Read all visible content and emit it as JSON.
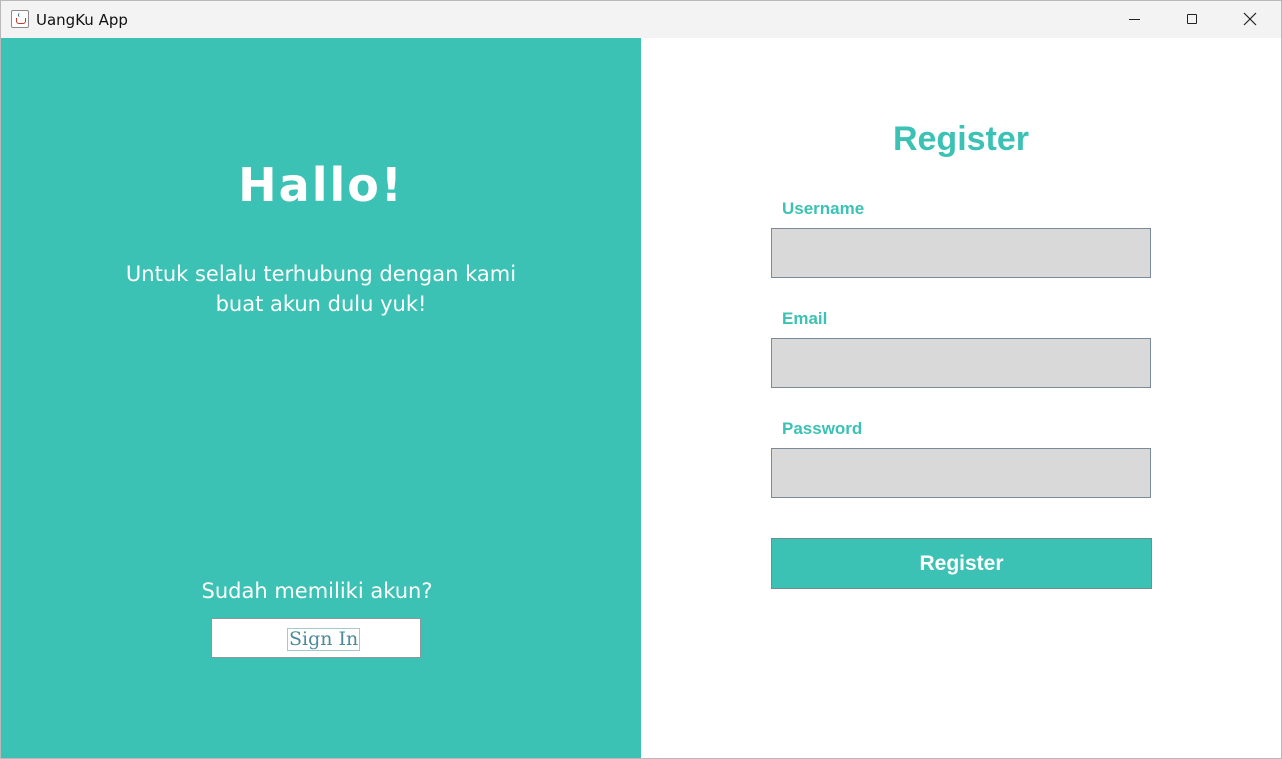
{
  "window": {
    "title": "UangKu App",
    "app_icon": "java-cup-icon",
    "controls": {
      "minimize_icon": "minimize-icon",
      "maximize_icon": "maximize-icon",
      "close_icon": "close-icon"
    }
  },
  "colors": {
    "accent": "#3cc2b4",
    "input_background": "#d9d9d9",
    "panel_text": "#ffffff"
  },
  "left_panel": {
    "greeting": "Hallo!",
    "subtitle_line1": "Untuk selalu terhubung dengan kami",
    "subtitle_line2": "buat akun dulu yuk!",
    "have_account": "Sudah memiliki akun?",
    "signin_label": "Sign In"
  },
  "form": {
    "title": "Register",
    "username_label": "Username",
    "username_value": "",
    "email_label": "Email",
    "email_value": "",
    "password_label": "Password",
    "password_value": "",
    "submit_label": "Register"
  }
}
